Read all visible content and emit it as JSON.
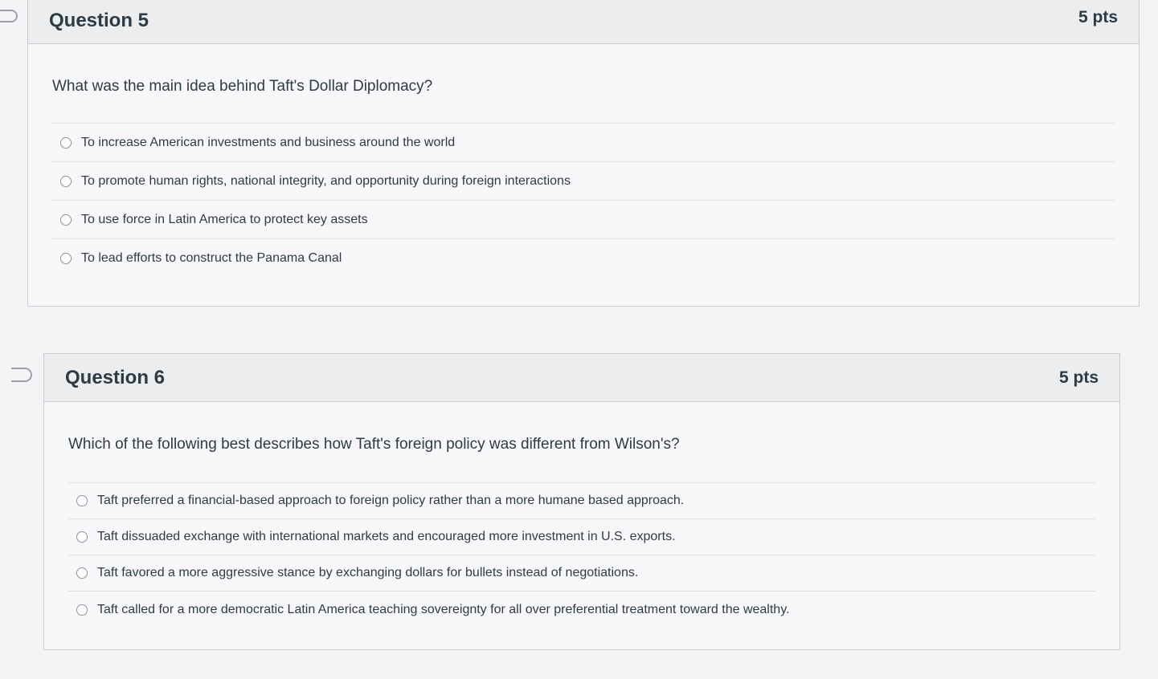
{
  "questions": [
    {
      "title": "Question 5",
      "points": "5 pts",
      "text": "What was the main idea behind Taft's Dollar Diplomacy?",
      "answers": [
        "To increase American investments and business around the world",
        "To promote human rights, national integrity, and opportunity during foreign interactions",
        "To use force in Latin America to protect key assets",
        "To lead efforts to construct the Panama Canal"
      ]
    },
    {
      "title": "Question 6",
      "points": "5 pts",
      "text": "Which of the following best describes how Taft's foreign policy was different from Wilson's?",
      "answers": [
        "Taft preferred a financial-based approach to foreign policy rather than a more humane based approach.",
        "Taft dissuaded exchange with international markets and encouraged more investment in U.S. exports.",
        "Taft favored a more aggressive stance by exchanging dollars for bullets instead of negotiations.",
        "Taft called for a more democratic Latin America teaching sovereignty for all over preferential treatment toward the wealthy."
      ]
    }
  ]
}
